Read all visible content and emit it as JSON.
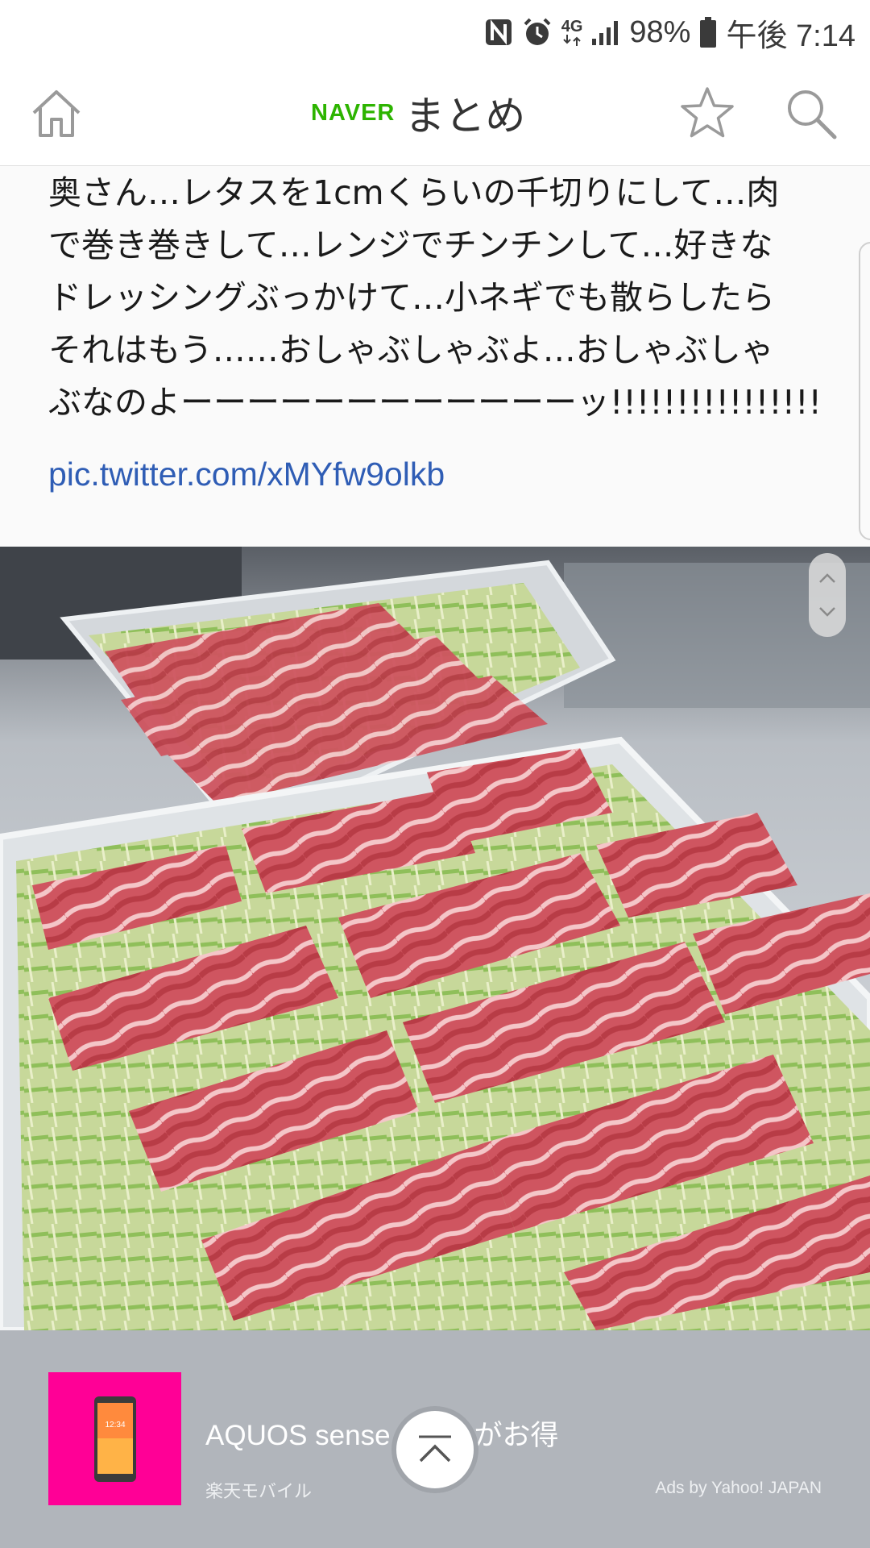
{
  "status_bar": {
    "network": "4G",
    "battery": "98%",
    "time": "午後 7:14",
    "icons": [
      "nfc-icon",
      "alarm-icon",
      "network-4g-icon",
      "signal-icon",
      "battery-icon"
    ]
  },
  "header": {
    "logo_brand": "NAVER",
    "logo_name": "まとめ",
    "icons": [
      "home-icon",
      "star-icon",
      "search-icon"
    ]
  },
  "tweet": {
    "lines": [
      "奥さん…レタスを1cmくらいの千切りにして…肉",
      "で巻き巻きして…レンジでチンチンして…好きな",
      "ドレッシングぶっかけて…小ネギでも散らしたら",
      "それはもう……おしゃぶしゃぶよ…おしゃぶしゃ",
      "ぶなのよーーーーーーーーーーーーッ!!!!!!!!!!!!!!!!"
    ],
    "link": "pic.twitter.com/xMYfw9olkb"
  },
  "photo": {
    "subject": "two glass dishes of lettuce wrapped in thin sliced pork"
  },
  "ad": {
    "title": "AQUOS sense",
    "title_tail": "がお得",
    "advertiser": "楽天モバイル",
    "credit": "Ads by Yahoo! JAPAN",
    "thumb_color": "#ff0096"
  },
  "colors": {
    "naver_green": "#2db400",
    "link_blue": "#2f5db5",
    "ad_bg": "#b1b5bb"
  }
}
